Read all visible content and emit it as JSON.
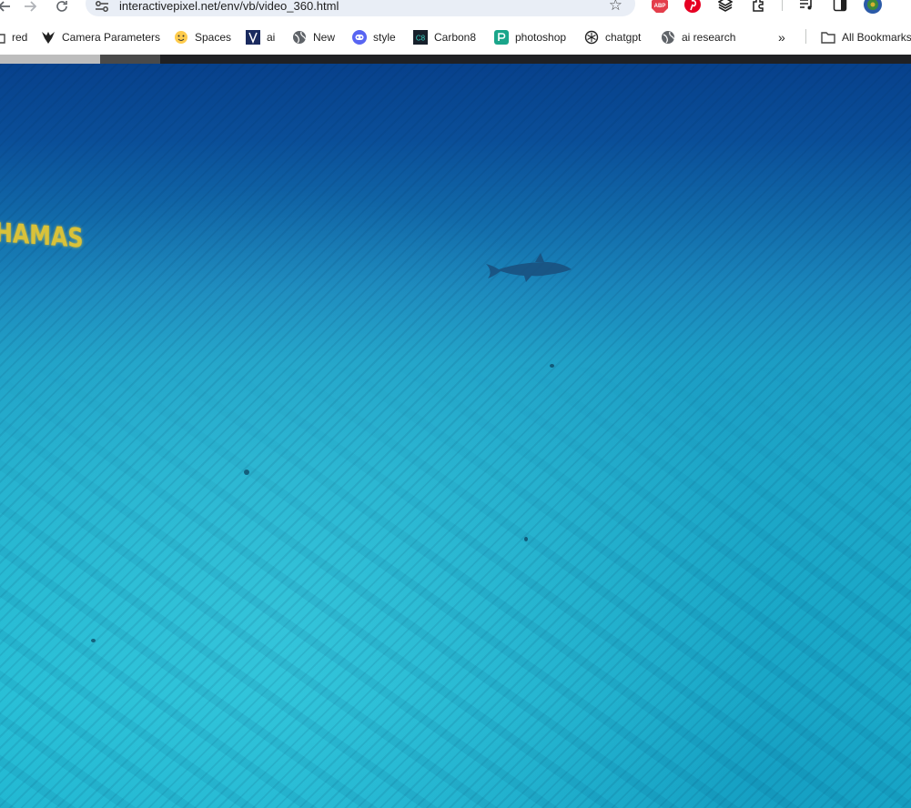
{
  "browser": {
    "url": "interactivepixel.net/env/vb/video_360.html",
    "bookmarks": [
      {
        "label": "red",
        "icon": "folder-icon"
      },
      {
        "label": "Camera Parameters",
        "icon": "bird-logo-icon"
      },
      {
        "label": "Spaces",
        "icon": "hugging-face-icon"
      },
      {
        "label": "ai",
        "icon": "ai-logo-icon"
      },
      {
        "label": "New",
        "icon": "globe-icon"
      },
      {
        "label": "style",
        "icon": "discord-icon"
      },
      {
        "label": "Carbon8",
        "icon": "carbon8-icon"
      },
      {
        "label": "photoshop",
        "icon": "photoshop-icon"
      },
      {
        "label": "chatgpt",
        "icon": "openai-icon"
      },
      {
        "label": "ai research",
        "icon": "globe-icon"
      }
    ],
    "all_bookmarks_label": "All Bookmarks",
    "carbon8_icon_text": "C8",
    "abp_badge": "ABP"
  },
  "video": {
    "overlay_text": "HAMAS"
  }
}
